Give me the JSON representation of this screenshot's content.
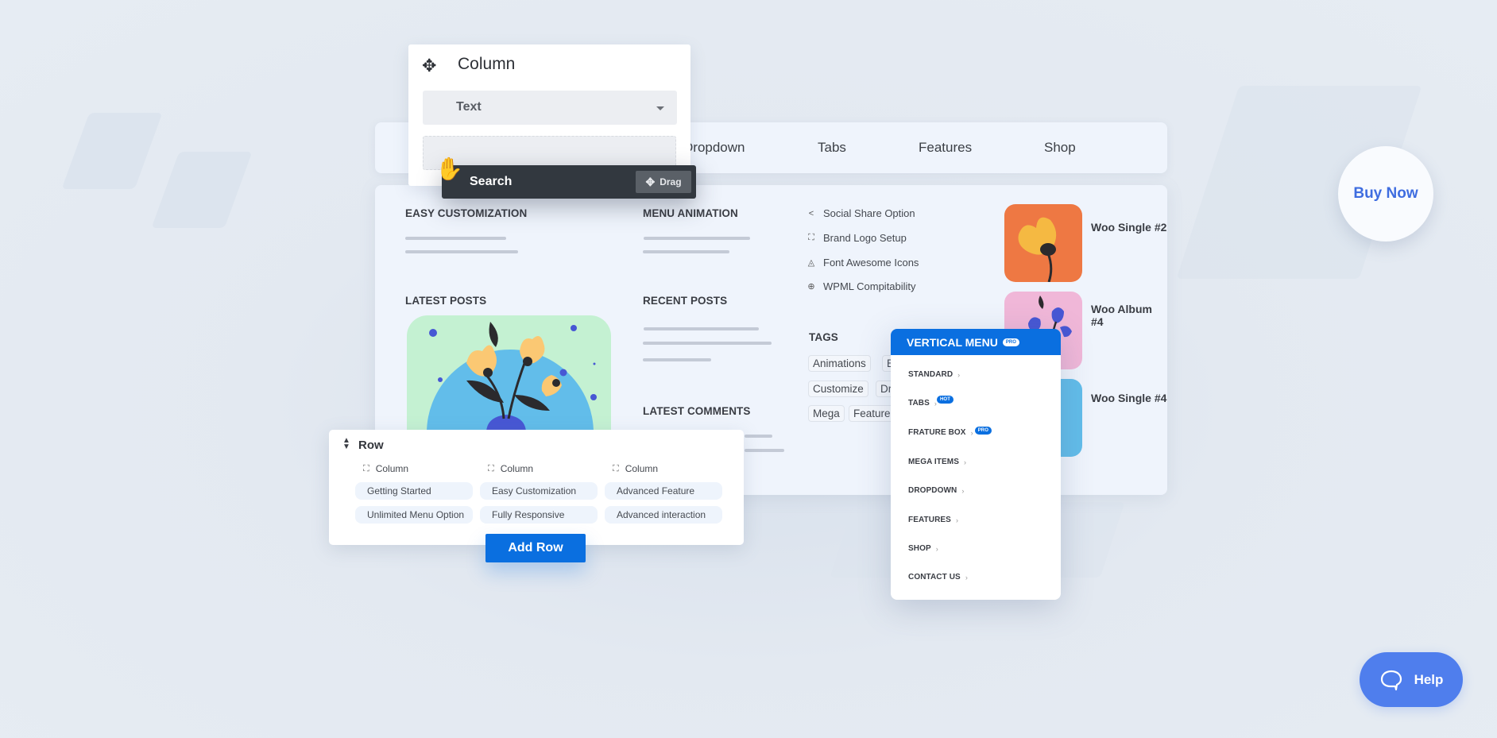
{
  "column_widget": {
    "title": "Column",
    "select_value": "Text",
    "drag_item_label": "Search",
    "drag_button_label": "Drag"
  },
  "navbar": {
    "items": [
      "Dropdown",
      "Tabs",
      "Features",
      "Shop"
    ]
  },
  "mega_panel": {
    "sections": {
      "easy_customization": "EASY CUSTOMIZATION",
      "menu_animation": "MENU ANIMATION",
      "latest_posts": "LATEST POSTS",
      "recent_posts": "RECENT POSTS",
      "latest_comments": "LATEST COMMENTS",
      "tags": "TAGS"
    },
    "features": [
      {
        "icon": "share-icon",
        "label": "Social Share Option"
      },
      {
        "icon": "expand-icon",
        "label": "Brand Logo Setup"
      },
      {
        "icon": "font-awesome-icon",
        "label": "Font Awesome Icons"
      },
      {
        "icon": "wpml-icon",
        "label": "WPML Compitability"
      }
    ],
    "tags": [
      "Animations",
      "Be",
      "Customize",
      "Dro",
      "Mega",
      "Feature"
    ],
    "products": [
      "Woo Single #2",
      "Woo Album #4",
      "Woo Single #4"
    ]
  },
  "row_widget": {
    "title": "Row",
    "columns": [
      {
        "label": "Column",
        "items": [
          "Getting Started",
          "Unlimited Menu Option"
        ]
      },
      {
        "label": "Column",
        "items": [
          "Easy Customization",
          "Fully Responsive"
        ]
      },
      {
        "label": "Column",
        "items": [
          "Advanced Feature",
          "Advanced interaction"
        ]
      }
    ],
    "add_row_label": "Add Row"
  },
  "vertical_menu": {
    "title": "VERTICAL MENU",
    "title_badge": "PRO",
    "items": [
      {
        "label": "STANDARD",
        "badge": ""
      },
      {
        "label": "TABS",
        "badge": "HOT"
      },
      {
        "label": "FRATURE BOX",
        "badge": "PRO"
      },
      {
        "label": "MEGA ITEMS",
        "badge": ""
      },
      {
        "label": "DROPDOWN",
        "badge": ""
      },
      {
        "label": "FEATURES",
        "badge": ""
      },
      {
        "label": "SHOP",
        "badge": ""
      },
      {
        "label": "CONTACT US",
        "badge": ""
      }
    ]
  },
  "buy_now_label": "Buy Now",
  "help_label": "Help",
  "colors": {
    "accent": "#0a6fe0",
    "buy_now_text": "#3f6de0",
    "help_bg": "#4f7eed",
    "drag_bar": "#32383f"
  }
}
